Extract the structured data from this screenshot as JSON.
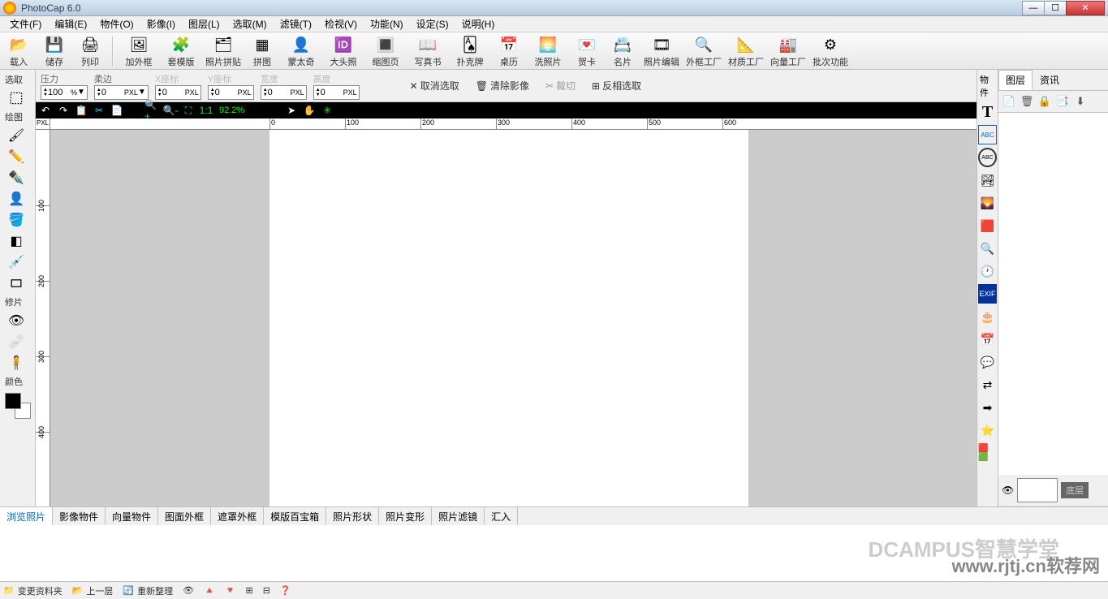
{
  "app": {
    "title": "PhotoCap 6.0"
  },
  "menu": [
    "文件(F)",
    "编辑(E)",
    "物件(O)",
    "影像(I)",
    "图层(L)",
    "选取(M)",
    "滤镜(T)",
    "检视(V)",
    "功能(N)",
    "设定(S)",
    "说明(H)"
  ],
  "toolbar": [
    {
      "name": "import",
      "label": "载入",
      "ico": "📂"
    },
    {
      "name": "save",
      "label": "储存",
      "ico": "💾"
    },
    {
      "name": "print",
      "label": "列印",
      "ico": "🖨"
    },
    {
      "sep": true
    },
    {
      "name": "add-frame",
      "label": "加外框",
      "ico": "🖼",
      "wide": true
    },
    {
      "name": "template",
      "label": "套模版",
      "ico": "🧩",
      "wide": true
    },
    {
      "name": "collage",
      "label": "照片拼贴",
      "ico": "🗂",
      "wide": true
    },
    {
      "name": "puzzle",
      "label": "拼图",
      "ico": "▦"
    },
    {
      "name": "montage",
      "label": "蒙太奇",
      "ico": "👤",
      "wide": true
    },
    {
      "name": "id-photo",
      "label": "大头照",
      "ico": "🆔",
      "wide": true
    },
    {
      "name": "thumb",
      "label": "缩图页",
      "ico": "🔳",
      "wide": true
    },
    {
      "name": "book",
      "label": "写真书",
      "ico": "📖",
      "wide": true
    },
    {
      "name": "poker",
      "label": "扑克牌",
      "ico": "🂡",
      "wide": true
    },
    {
      "name": "calendar",
      "label": "桌历",
      "ico": "📅"
    },
    {
      "name": "develop",
      "label": "洗照片",
      "ico": "🌅",
      "wide": true
    },
    {
      "name": "greeting",
      "label": "贺卡",
      "ico": "💌"
    },
    {
      "name": "namecard",
      "label": "名片",
      "ico": "📇"
    },
    {
      "name": "edit",
      "label": "照片编辑",
      "ico": "🎞",
      "wide": true
    },
    {
      "name": "frame-factory",
      "label": "外框工厂",
      "ico": "🔍",
      "wide": true
    },
    {
      "name": "material-factory",
      "label": "材质工厂",
      "ico": "📐",
      "wide": true
    },
    {
      "name": "vector-factory",
      "label": "向量工厂",
      "ico": "🏭",
      "wide": true
    },
    {
      "name": "batch",
      "label": "批次功能",
      "ico": "⚙",
      "wide": true
    }
  ],
  "left": {
    "select_hdr": "选取",
    "draw_hdr": "绘图",
    "retouch_hdr": "修片",
    "color_hdr": "颜色"
  },
  "options": {
    "pressure_lbl": "压力",
    "pressure_val": "100",
    "soft_lbl": "柔边",
    "soft_val": "0",
    "x_lbl": "X座标",
    "x_val": "0",
    "y_lbl": "Y座标",
    "y_val": "0",
    "w_lbl": "宽度",
    "w_val": "0",
    "h_lbl": "高度",
    "h_val": "0",
    "px": "PXL",
    "cancel_sel": "取消选取",
    "clear_img": "清除影像",
    "crop": "裁切",
    "invert": "反相选取",
    "pct": "%"
  },
  "zoom": "92.2%",
  "ruler_unit": "PXL",
  "right": {
    "obj_hdr": "物件",
    "tabs": [
      "图层",
      "资讯"
    ],
    "layer_name": "底层"
  },
  "bottom": {
    "tabs": [
      "浏览照片",
      "影像物件",
      "向量物件",
      "图面外框",
      "遮罩外框",
      "模版百宝箱",
      "照片形状",
      "照片变形",
      "照片滤镜",
      "汇入"
    ],
    "active": 0
  },
  "status": {
    "change_folder": "变更资料夹",
    "up": "上一层",
    "refresh": "重新整理"
  },
  "wm1": "DCAMPUS智慧学堂",
  "wm2": "www.rjtj.cn软荐网",
  "hruler": [
    0,
    100,
    200,
    300,
    400,
    500,
    600
  ],
  "vruler": [
    100,
    200,
    300,
    400
  ]
}
